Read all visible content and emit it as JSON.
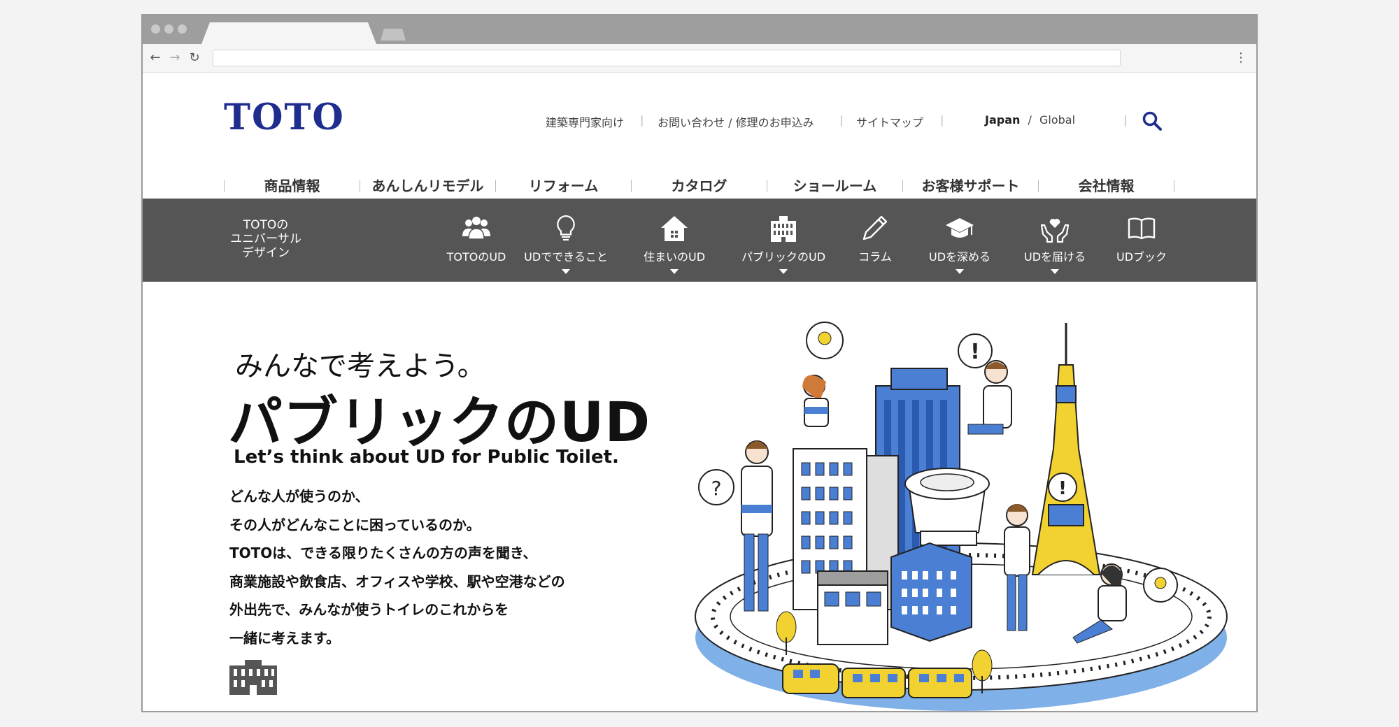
{
  "browser": {
    "address": "",
    "nav": {
      "back": "←",
      "forward": "→",
      "reload": "↻",
      "menu": "⋮"
    }
  },
  "header": {
    "logo": "TOTO",
    "utility_links": [
      "建築専門家向け",
      "お問い合わせ / 修理のお申込み",
      "サイトマップ"
    ],
    "lang": {
      "japan": "Japan",
      "sep": "/",
      "global": "Global"
    },
    "search_icon": "search-icon",
    "brand_color": "#1f2d8f"
  },
  "main_nav": [
    "商品情報",
    "あんしんリモデル",
    "リフォーム",
    "カタログ",
    "ショールーム",
    "お客様サポート",
    "会社情報"
  ],
  "ud_bar": {
    "title": "TOTOの\nユニバーサル\nデザイン",
    "background": "#555555",
    "items": [
      {
        "label": "TOTOのUD",
        "icon": "people-icon",
        "dropdown": false
      },
      {
        "label": "UDでできること",
        "icon": "lightbulb-icon",
        "dropdown": true
      },
      {
        "label": "住まいのUD",
        "icon": "house-icon",
        "dropdown": true
      },
      {
        "label": "パブリックのUD",
        "icon": "building-icon",
        "dropdown": true
      },
      {
        "label": "コラム",
        "icon": "pencil-icon",
        "dropdown": false
      },
      {
        "label": "UDを深める",
        "icon": "graduation-cap-icon",
        "dropdown": true
      },
      {
        "label": "UDを届ける",
        "icon": "heart-hands-icon",
        "dropdown": true
      },
      {
        "label": "UDブック",
        "icon": "book-icon",
        "dropdown": false
      }
    ]
  },
  "hero": {
    "subtitle": "みんなで考えよう。",
    "title": "パブリックのUD",
    "english": "Let’s think about UD for Public Toilet.",
    "body": [
      "どんな人が使うのか、",
      "その人がどんなことに困っているのか。",
      "TOTOは、できる限りたくさんの方の声を聞き、",
      "商業施設や飲食店、オフィスや学校、駅や空港などの",
      "外出先で、みんなが使うトイレのこれからを",
      "一緒に考えます。"
    ],
    "section_icon": "building-icon"
  },
  "illustration": {
    "accent_blue": "#4a7fd4",
    "accent_yellow": "#f2d230"
  }
}
